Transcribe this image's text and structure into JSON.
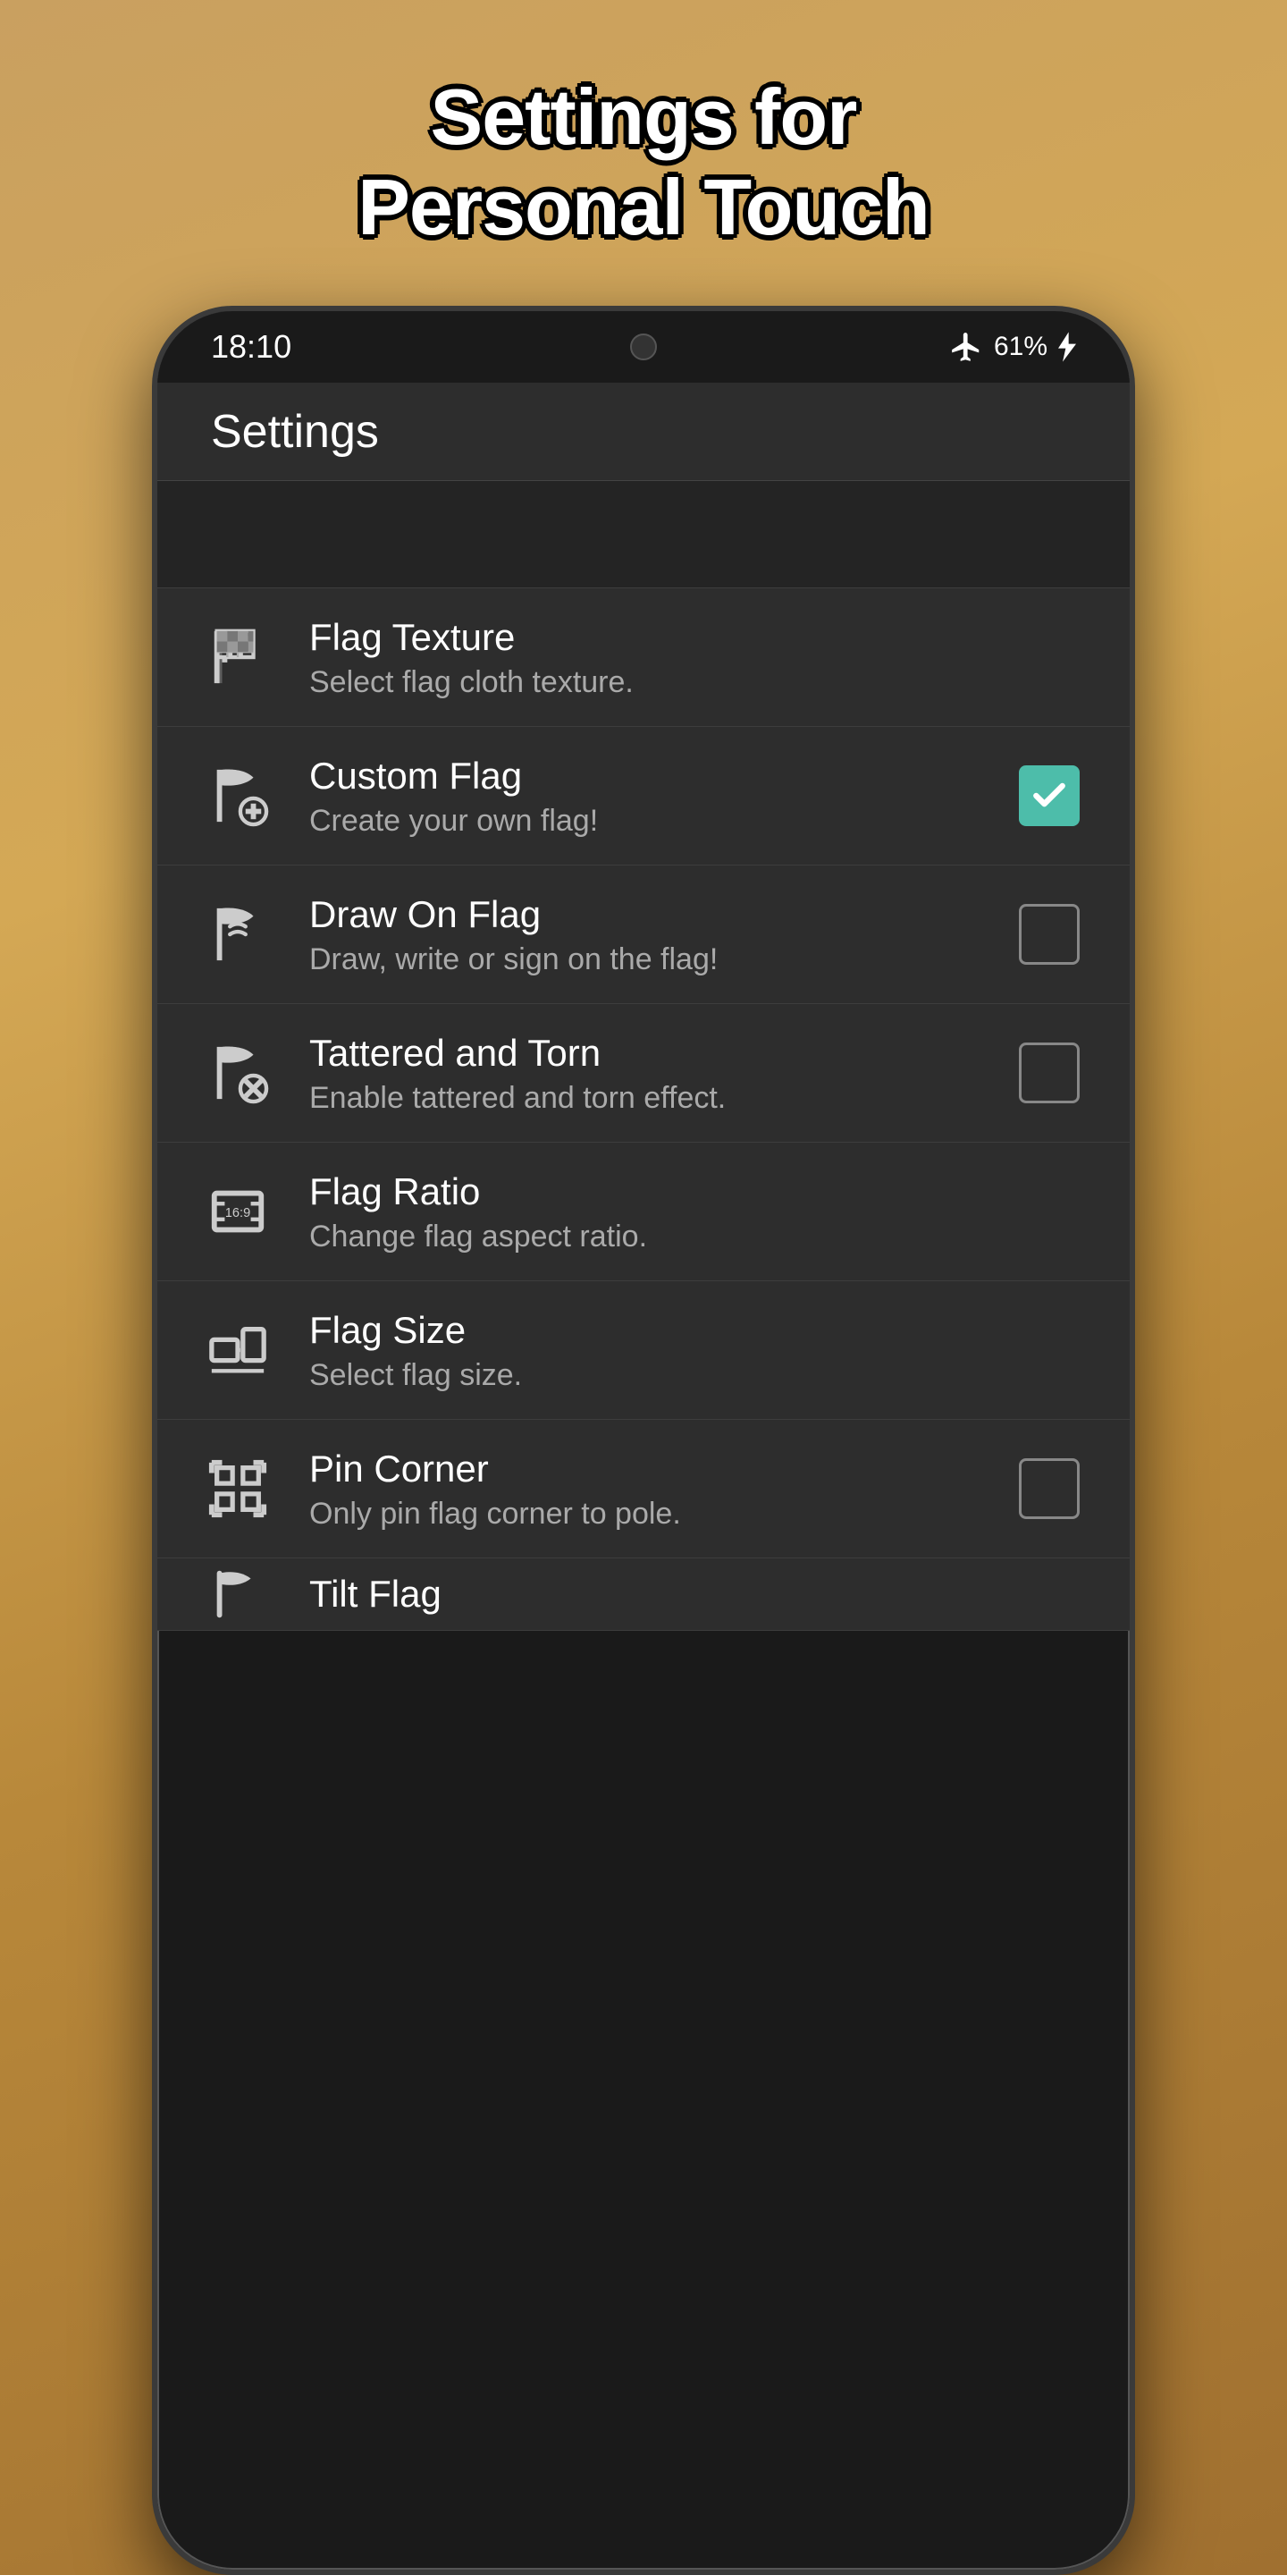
{
  "page": {
    "background_title_line1": "Settings for",
    "background_title_line2": "Personal Touch"
  },
  "status_bar": {
    "time": "18:10",
    "battery": "61%"
  },
  "app_bar": {
    "title": "Settings"
  },
  "settings_items": [
    {
      "id": "flag-texture",
      "title": "Flag Texture",
      "subtitle": "Select flag cloth texture.",
      "icon": "flag-texture-icon",
      "control": "none"
    },
    {
      "id": "custom-flag",
      "title": "Custom Flag",
      "subtitle": "Create your own flag!",
      "icon": "custom-flag-icon",
      "control": "checkbox-checked"
    },
    {
      "id": "draw-on-flag",
      "title": "Draw On Flag",
      "subtitle": "Draw, write or sign on the flag!",
      "icon": "draw-flag-icon",
      "control": "checkbox-unchecked"
    },
    {
      "id": "tattered-torn",
      "title": "Tattered and Torn",
      "subtitle": "Enable tattered and torn effect.",
      "icon": "tattered-flag-icon",
      "control": "checkbox-unchecked"
    },
    {
      "id": "flag-ratio",
      "title": "Flag Ratio",
      "subtitle": "Change flag aspect ratio.",
      "icon": "flag-ratio-icon",
      "control": "none"
    },
    {
      "id": "flag-size",
      "title": "Flag Size",
      "subtitle": "Select flag size.",
      "icon": "flag-size-icon",
      "control": "none"
    },
    {
      "id": "pin-corner",
      "title": "Pin Corner",
      "subtitle": "Only pin flag corner to pole.",
      "icon": "pin-corner-icon",
      "control": "checkbox-unchecked"
    },
    {
      "id": "tilt-flag",
      "title": "Tilt Flag",
      "subtitle": "",
      "icon": "tilt-flag-icon",
      "control": "none"
    }
  ]
}
